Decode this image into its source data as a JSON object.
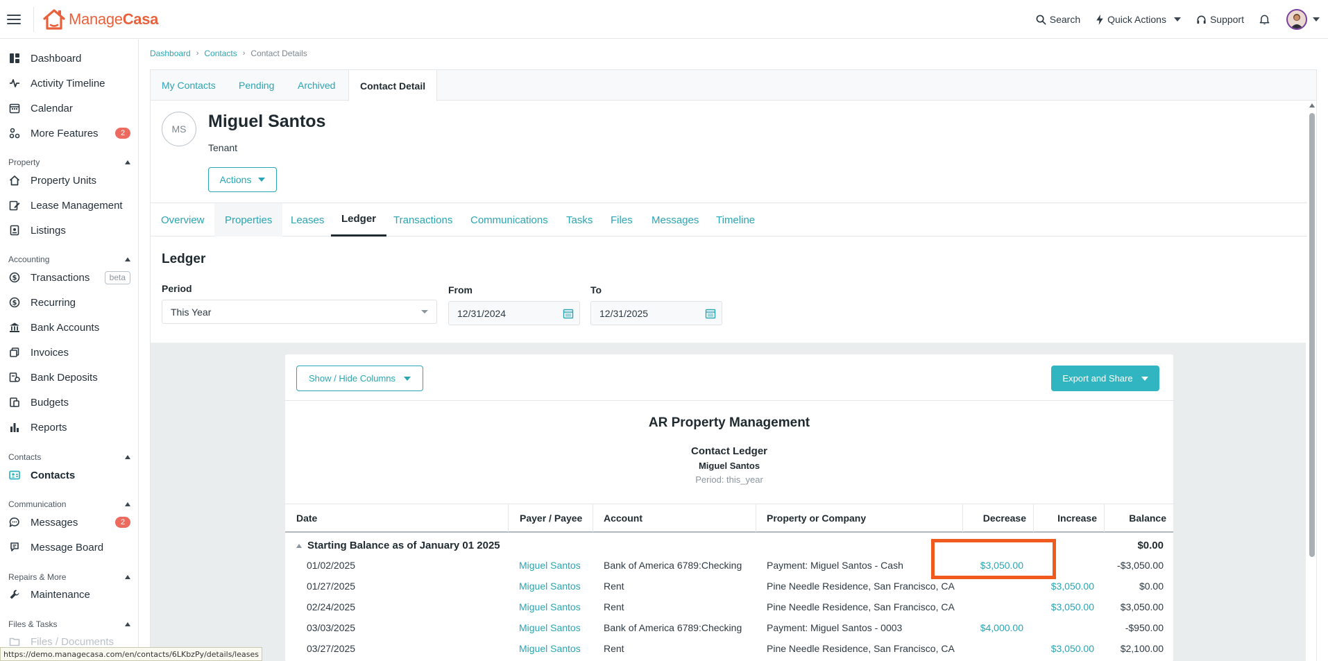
{
  "app": {
    "logo_text_a": "Manage",
    "logo_text_b": "Casa"
  },
  "topbar": {
    "search": "Search",
    "quick_actions": "Quick Actions",
    "support": "Support"
  },
  "sidebar": {
    "items_top": [
      {
        "label": "Dashboard",
        "icon": "dashboard-icon"
      },
      {
        "label": "Activity Timeline",
        "icon": "activity-icon"
      },
      {
        "label": "Calendar",
        "icon": "calendar-icon"
      },
      {
        "label": "More Features",
        "icon": "features-icon",
        "badge": "2"
      }
    ],
    "property_section": "Property",
    "property_items": [
      "Property Units",
      "Lease Management",
      "Listings"
    ],
    "accounting_section": "Accounting",
    "accounting_items": [
      "Transactions",
      "Recurring",
      "Bank Accounts",
      "Invoices",
      "Bank Deposits",
      "Budgets",
      "Reports"
    ],
    "beta_label": "beta",
    "contacts_section": "Contacts",
    "contacts_items": [
      "Contacts"
    ],
    "communication_section": "Communication",
    "communication_items": [
      "Messages",
      "Message Board"
    ],
    "messages_badge": "2",
    "repairs_section": "Repairs & More",
    "repairs_items": [
      "Maintenance"
    ],
    "files_section": "Files & Tasks",
    "files_items": [
      "Files / Documents"
    ]
  },
  "status_url": "https://demo.managecasa.com/en/contacts/6LKbzPy/details/leases",
  "breadcrumb": {
    "dashboard": "Dashboard",
    "contacts": "Contacts",
    "current": "Contact Details"
  },
  "top_tabs": [
    "My Contacts",
    "Pending",
    "Archived",
    "Contact Detail"
  ],
  "contact": {
    "initials": "MS",
    "name": "Miguel Santos",
    "role": "Tenant",
    "actions_label": "Actions"
  },
  "sub_tabs": [
    "Overview",
    "Properties",
    "Leases",
    "Ledger",
    "Transactions",
    "Communications",
    "Tasks",
    "Files",
    "Messages",
    "Timeline"
  ],
  "ledger": {
    "title": "Ledger",
    "period_label": "Period",
    "period_value": "This Year",
    "from_label": "From",
    "from_value": "12/31/2024",
    "to_label": "To",
    "to_value": "12/31/2025"
  },
  "report": {
    "show_hide": "Show / Hide Columns",
    "export": "Export and Share",
    "company": "AR Property Management",
    "title": "Contact Ledger",
    "name": "Miguel Santos",
    "period": "Period: this_year",
    "columns": [
      "Date",
      "Payer / Payee",
      "Account",
      "Property or Company",
      "Decrease",
      "Increase",
      "Balance"
    ],
    "starting_label": "Starting Balance as of January 01 2025",
    "starting_balance": "$0.00",
    "rows": [
      {
        "date": "01/02/2025",
        "payee": "Miguel Santos",
        "account": "Bank of America 6789:Checking",
        "property": "Payment: Miguel Santos - Cash",
        "decrease": "$3,050.00",
        "increase": "",
        "balance": "-$3,050.00"
      },
      {
        "date": "01/27/2025",
        "payee": "Miguel Santos",
        "account": "Rent",
        "property": "Pine Needle Residence, San Francisco, CA",
        "decrease": "",
        "increase": "$3,050.00",
        "balance": "$0.00"
      },
      {
        "date": "02/24/2025",
        "payee": "Miguel Santos",
        "account": "Rent",
        "property": "Pine Needle Residence, San Francisco, CA",
        "decrease": "",
        "increase": "$3,050.00",
        "balance": "$3,050.00"
      },
      {
        "date": "03/03/2025",
        "payee": "Miguel Santos",
        "account": "Bank of America 6789:Checking",
        "property": "Payment: Miguel Santos - 0003",
        "decrease": "$4,000.00",
        "increase": "",
        "balance": "-$950.00"
      },
      {
        "date": "03/27/2025",
        "payee": "Miguel Santos",
        "account": "Rent",
        "property": "Pine Needle Residence, San Francisco, CA",
        "decrease": "",
        "increase": "$3,050.00",
        "balance": "$2,100.00"
      }
    ]
  },
  "colors": {
    "accent": "#2aa5b3",
    "brand": "#e8613c",
    "badge": "#ec6a5e",
    "highlight": "#f15a1e"
  }
}
